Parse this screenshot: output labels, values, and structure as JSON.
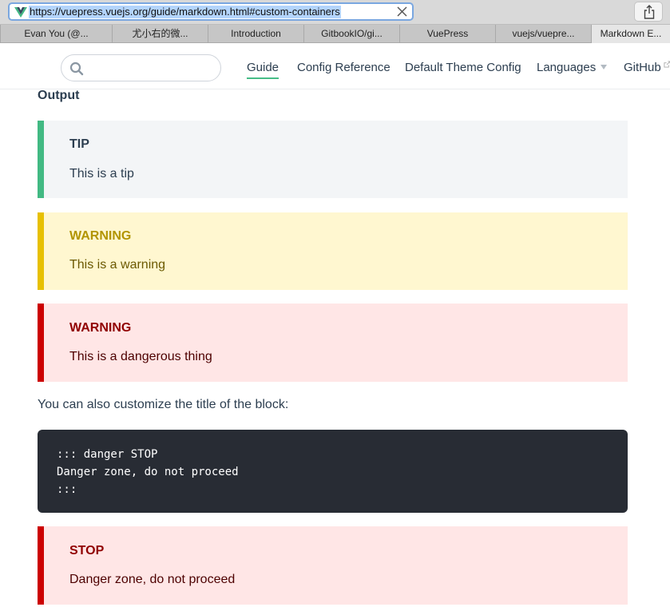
{
  "browser": {
    "url": "https://vuepress.vuejs.org/guide/markdown.html#custom-containers",
    "tabs": [
      {
        "label": "Evan You (@..."
      },
      {
        "label": "尤小右的微..."
      },
      {
        "label": "Introduction"
      },
      {
        "label": "GitbookIO/gi..."
      },
      {
        "label": "VuePress"
      },
      {
        "label": "vuejs/vuepre..."
      },
      {
        "label": "Markdown E..."
      }
    ],
    "active_tab_index": 6
  },
  "nav": {
    "search_placeholder": "",
    "links": [
      {
        "label": "Guide"
      },
      {
        "label": "Config Reference"
      },
      {
        "label": "Default Theme Config"
      },
      {
        "label": "Languages"
      },
      {
        "label": "GitHub"
      }
    ],
    "active_link": "Guide"
  },
  "content": {
    "output_heading": "Output",
    "tip": {
      "title": "TIP",
      "text": "This is a tip"
    },
    "warning": {
      "title": "WARNING",
      "text": "This is a warning"
    },
    "danger": {
      "title": "WARNING",
      "text": "This is a dangerous thing"
    },
    "customize_text": "You can also customize the title of the block:",
    "code_lines": [
      "::: danger STOP",
      "Danger zone, do not proceed",
      ":::"
    ],
    "stop": {
      "title": "STOP",
      "text": "Danger zone, do not proceed"
    }
  },
  "colors": {
    "accent": "#42b983",
    "tip_border": "#42b983",
    "warning_border": "#e7c000",
    "danger_border": "#cc0000",
    "code_background": "#282c34"
  },
  "icons": {
    "favicon": "vue-logo-icon",
    "clear": "close-icon",
    "share": "share-icon",
    "search": "search-icon",
    "dropdown": "caret-down-icon",
    "external": "external-link-icon"
  }
}
